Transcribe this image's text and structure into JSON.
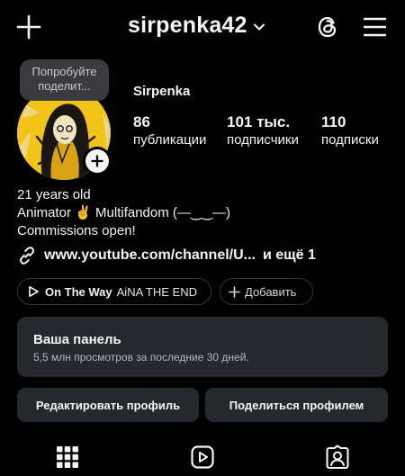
{
  "header": {
    "username": "sirpenka42"
  },
  "profile": {
    "note": "Попробуйте поделит...",
    "display_name": "Sirpenka",
    "stats": [
      {
        "num": "86",
        "label": "публикации"
      },
      {
        "num": "101 тыс.",
        "label": "подписчики"
      },
      {
        "num": "110",
        "label": "подписки"
      }
    ],
    "bio": {
      "line1": "21 years old",
      "line2": "Animator ✌️ Multifandom (—‿‿—)",
      "line3": "Commissions open!"
    },
    "link": {
      "url": "www.youtube.com/channel/U...",
      "more": "и ещё 1"
    }
  },
  "chips": {
    "song": "On The Way",
    "artist": "AiNA THE END",
    "add_label": "Добавить"
  },
  "dashboard": {
    "title": "Ваша панель",
    "subtitle": "5,5 млн просмотров за последние 30 дней."
  },
  "buttons": {
    "edit": "Редактировать профиль",
    "share": "Поделиться профилем"
  },
  "icons": {
    "new_post": "plus-icon",
    "account_switch": "chevron-down-icon",
    "threads": "threads-icon",
    "menu": "hamburger-menu-icon",
    "add_story": "plus-circle-icon",
    "link": "link-icon",
    "music": "play-icon",
    "grid_tab": "grid-icon",
    "reels_tab": "reels-icon",
    "tagged_tab": "tagged-icon"
  }
}
